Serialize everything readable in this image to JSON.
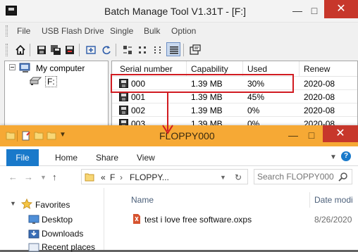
{
  "batch_manager": {
    "title": "Batch Manage Tool V1.31T  - [F:]",
    "menu": [
      "File",
      "USB Flash Drive",
      "Single",
      "Bulk",
      "Option"
    ],
    "tree": {
      "root": "My computer",
      "child": "F:"
    },
    "columns": [
      "Serial number",
      "Capability",
      "Used",
      "Renew"
    ],
    "rows": [
      {
        "serial": "000",
        "capability": "1.39 MB",
        "used": "30%",
        "renew": "2020-08"
      },
      {
        "serial": "001",
        "capability": "1.39 MB",
        "used": "45%",
        "renew": "2020-08"
      },
      {
        "serial": "002",
        "capability": "1.39 MB",
        "used": "0%",
        "renew": "2020-08"
      },
      {
        "serial": "003",
        "capability": "1.39 MB",
        "used": "0%",
        "renew": "2020-08"
      }
    ],
    "highlight_color": "#d11b21"
  },
  "explorer": {
    "title": "FLOPPY000",
    "ribbon_tabs": {
      "file": "File",
      "home": "Home",
      "share": "Share",
      "view": "View"
    },
    "address": {
      "chevrons": "«",
      "seg1": "F",
      "seg2": "FLOPPY...",
      "sep": "›"
    },
    "search_placeholder": "Search FLOPPY000",
    "nav": {
      "favorites": "Favorites",
      "desktop": "Desktop",
      "downloads": "Downloads",
      "recent": "Recent places"
    },
    "columns": {
      "name": "Name",
      "date": "Date modi"
    },
    "file": {
      "name": "test i love free software.oxps",
      "date": "8/26/2020"
    },
    "accent_color": "#f6a935",
    "file_tab_color": "#1979ca"
  }
}
